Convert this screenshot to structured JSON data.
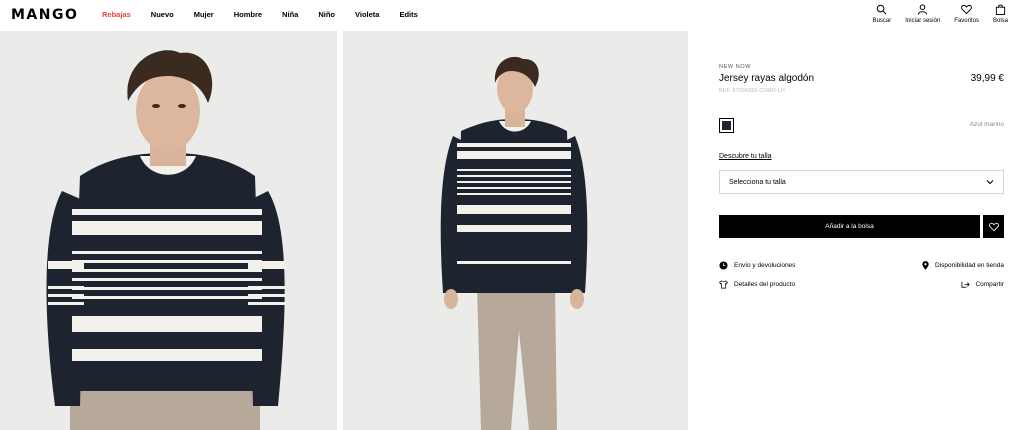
{
  "header": {
    "logo": "MANGO",
    "nav": [
      "Rebajas",
      "Nuevo",
      "Mujer",
      "Hombre",
      "Niña",
      "Niño",
      "Violeta",
      "Edits"
    ],
    "icons": {
      "search": "Buscar",
      "login": "Iniciar sesión",
      "favorites": "Favoritos",
      "bag": "Bolsa"
    }
  },
  "product": {
    "tag": "NEW NOW",
    "title": "Jersey rayas algodón",
    "price": "39,99 €",
    "ref": "REF. 67034382-COMO-LH",
    "color_name": "Azul marino",
    "color_hex": "#1d2430",
    "size_link": "Descubre tu talla",
    "size_placeholder": "Selecciona tu talla",
    "add_button": "Añadir a la bolsa",
    "shipping": "Envío y devoluciones",
    "store": "Disponibilidad en tienda",
    "details": "Detalles del producto",
    "share": "Compartir"
  },
  "colors": {
    "sale": "#e0473e",
    "navy": "#1d2430"
  }
}
